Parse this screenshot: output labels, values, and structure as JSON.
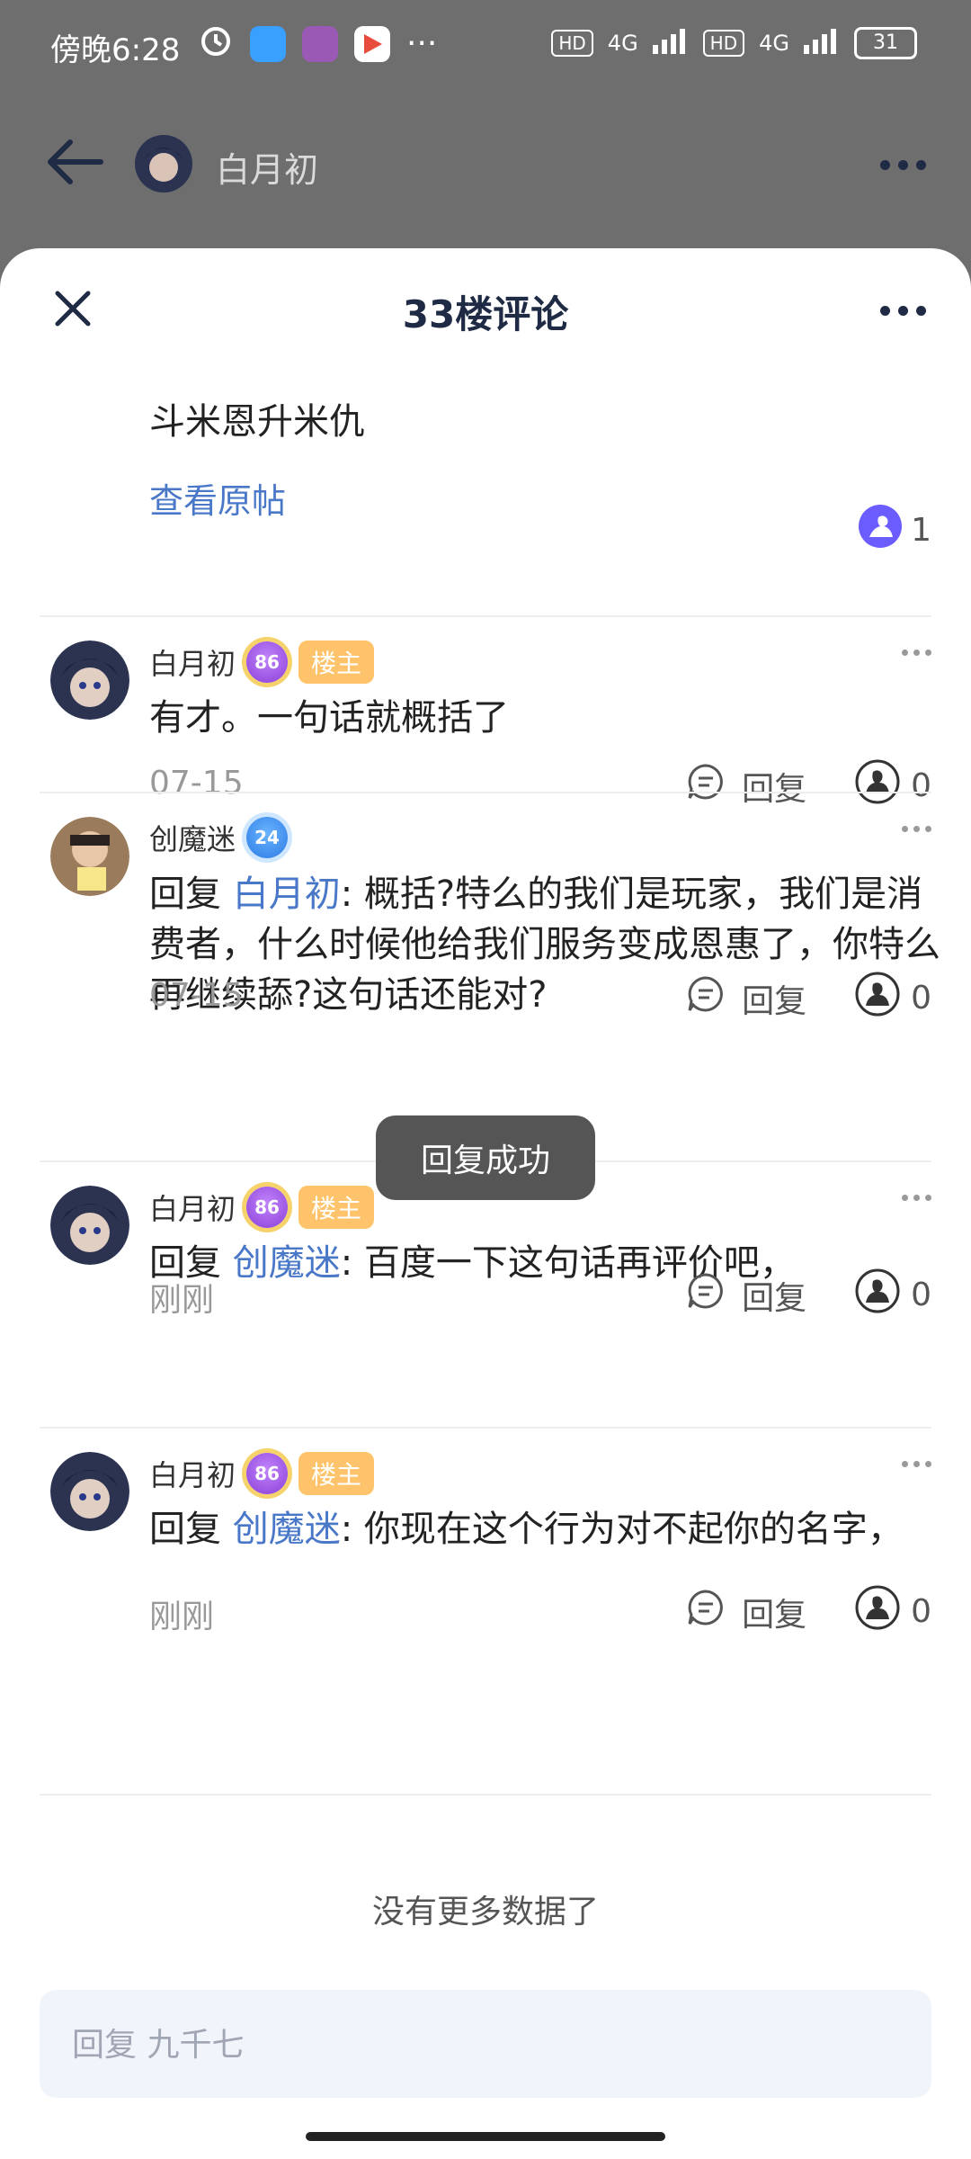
{
  "status_bar": {
    "time": "傍晚6:28",
    "battery": "31",
    "network_labels": [
      "HD",
      "4G",
      "HD",
      "4G"
    ]
  },
  "top_bar": {
    "title": "白月初"
  },
  "sheet": {
    "title": "33楼评论",
    "original_text": "斗米恩升米仇",
    "view_original_label": "查看原帖",
    "original_like_count": "1"
  },
  "comments": [
    {
      "user": "白月初",
      "level": "86",
      "host_badge": "楼主",
      "reply_prefix": "",
      "mention": "",
      "text": "有才。一句话就概括了",
      "time": "07-15",
      "reply_label": "回复",
      "likes": "0"
    },
    {
      "user": "创魔迷",
      "level": "24",
      "host_badge": "",
      "reply_prefix": "回复",
      "mention": "白月初",
      "text": ": 概括?特么的我们是玩家，我们是消费者，什么时候他给我们服务变成恩惠了，你特么再继续舔?这句话还能对?",
      "time": "07-15",
      "reply_label": "回复",
      "likes": "0"
    },
    {
      "user": "白月初",
      "level": "86",
      "host_badge": "楼主",
      "reply_prefix": "回复",
      "mention": "创魔迷",
      "text": ": 百度一下这句话再评价吧，",
      "time": "刚刚",
      "reply_label": "回复",
      "likes": "0"
    },
    {
      "user": "白月初",
      "level": "86",
      "host_badge": "楼主",
      "reply_prefix": "回复",
      "mention": "创魔迷",
      "text": ": 你现在这个行为对不起你的名字，",
      "time": "刚刚",
      "reply_label": "回复",
      "likes": "0"
    }
  ],
  "toast": "回复成功",
  "no_more": "没有更多数据了",
  "reply_input": {
    "placeholder": "回复 九千七"
  },
  "colors": {
    "accent_link": "#4a78c8",
    "host_badge": "#ffc46b",
    "overlay": "#6e6e6e"
  }
}
